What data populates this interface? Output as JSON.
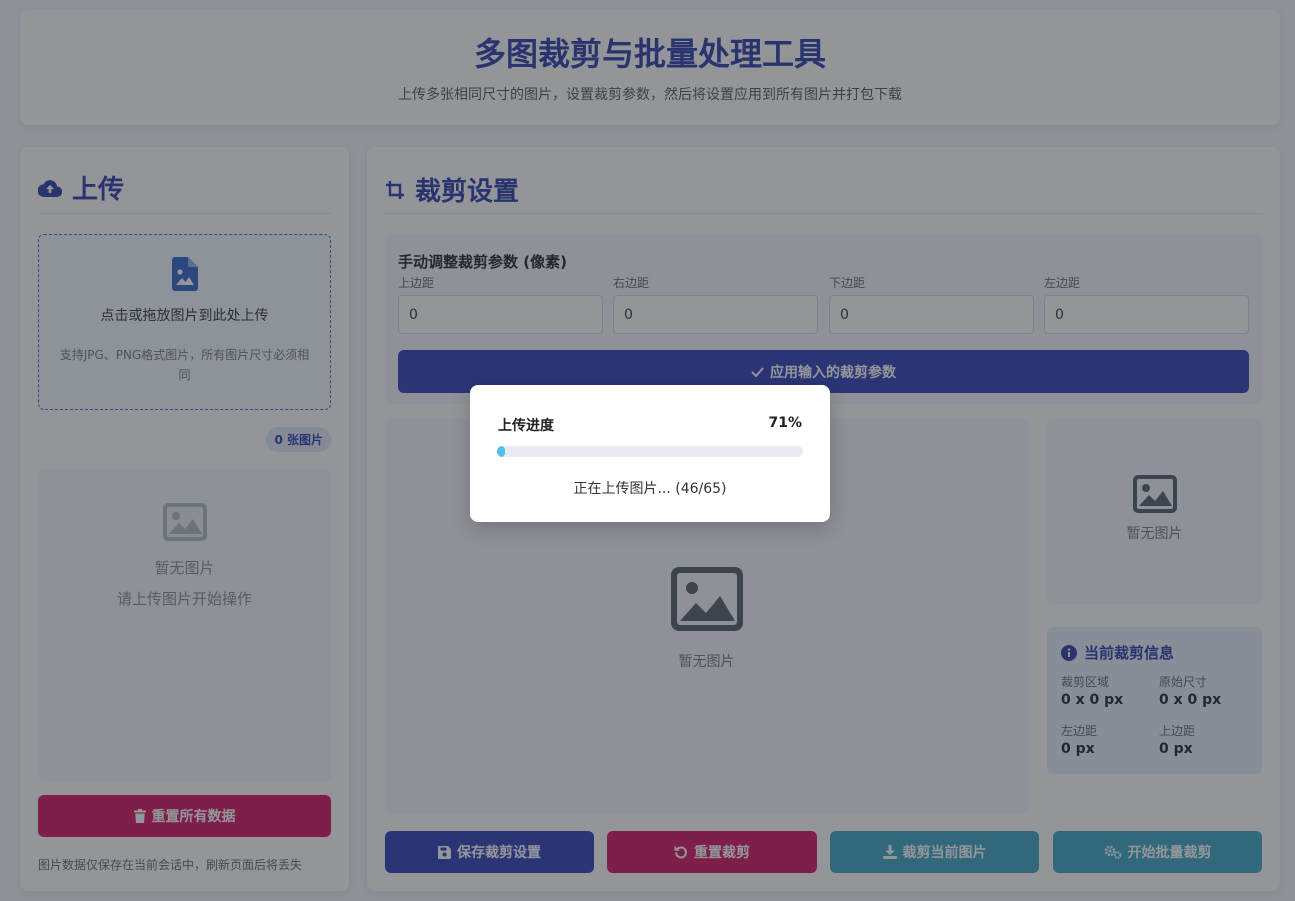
{
  "header": {
    "title": "多图裁剪与批量处理工具",
    "subtitle": "上传多张相同尺寸的图片，设置裁剪参数，然后将设置应用到所有图片并打包下载"
  },
  "upload": {
    "title": "上传",
    "drop_main": "点击或拖放图片到此处上传",
    "drop_sub": "支持JPG、PNG格式图片，所有图片尺寸必须相同",
    "count_badge": "0 张图片",
    "empty_line1": "暂无图片",
    "empty_line2": "请上传图片开始操作",
    "reset_all_label": "重置所有数据",
    "note": "图片数据仅保存在当前会话中，刷新页面后将丢失"
  },
  "crop": {
    "title": "裁剪设置",
    "manual_title": "手动调整裁剪参数 (像素)",
    "fields": [
      {
        "label": "上边距",
        "value": "0"
      },
      {
        "label": "右边距",
        "value": "0"
      },
      {
        "label": "下边距",
        "value": "0"
      },
      {
        "label": "左边距",
        "value": "0"
      }
    ],
    "apply_label": "应用输入的裁剪参数",
    "main_empty": "暂无图片",
    "side_empty": "暂无图片",
    "info": {
      "title": "当前裁剪信息",
      "items": [
        {
          "label": "裁剪区域",
          "value": "0 x 0 px"
        },
        {
          "label": "原始尺寸",
          "value": "0 x 0 px"
        },
        {
          "label": "左边距",
          "value": "0 px"
        },
        {
          "label": "上边距",
          "value": "0 px"
        }
      ]
    },
    "buttons": {
      "save": "保存裁剪设置",
      "reset": "重置裁剪",
      "crop_current": "裁剪当前图片",
      "batch": "开始批量裁剪"
    }
  },
  "modal": {
    "label": "上传进度",
    "percent_text": "71%",
    "progress_fraction": 0.02,
    "status": "正在上传图片... (46/65)"
  },
  "colors": {
    "primary": "#2e3fb8",
    "danger": "#d5135f",
    "info": "#3aa4c4",
    "progress": "#4fc1ea"
  }
}
